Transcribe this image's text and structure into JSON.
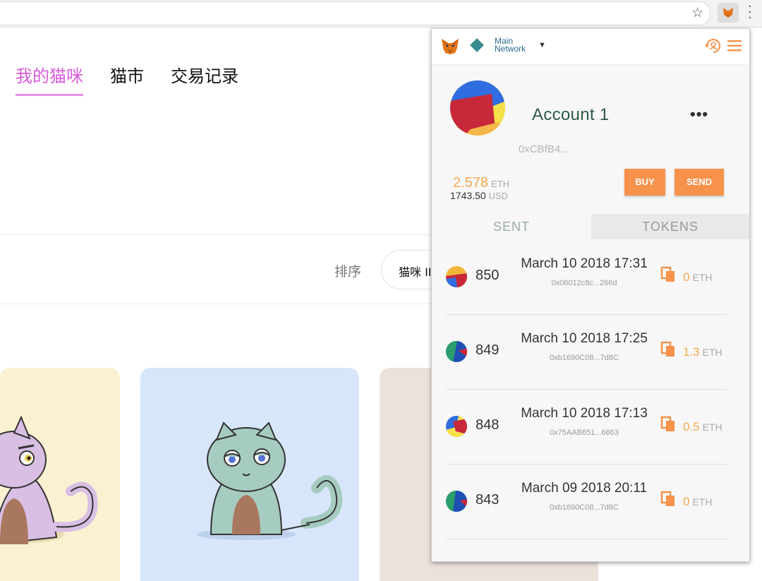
{
  "page": {
    "nav_tabs": [
      "我的猫咪",
      "猫市",
      "交易记录"
    ],
    "sort_label": "排序",
    "sort_value": "猫咪 II"
  },
  "metamask": {
    "network_line1": "Main",
    "network_line2": "Network",
    "account_name": "Account 1",
    "account_menu": "•••",
    "address": "0xCBfB4...",
    "balance_eth": "2.578",
    "balance_eth_unit": "ETH",
    "balance_usd": "1743.50",
    "balance_usd_unit": "USD",
    "buy_label": "BUY",
    "send_label": "SEND",
    "tabs": [
      "SENT",
      "TOKENS"
    ],
    "transactions": [
      {
        "id": "850",
        "date": "March 10 2018 17:31",
        "hash": "0x06012c8c...266d",
        "amount": "0",
        "unit": "ETH"
      },
      {
        "id": "849",
        "date": "March 10 2018 17:25",
        "hash": "0xb1690C08...7d8C",
        "amount": "1.3",
        "unit": "ETH"
      },
      {
        "id": "848",
        "date": "March 10 2018 17:13",
        "hash": "0x75AAB651...6863",
        "amount": "0.5",
        "unit": "ETH"
      },
      {
        "id": "843",
        "date": "March 09 2018 20:11",
        "hash": "0xb1690C08...7d8C",
        "amount": "0",
        "unit": "ETH"
      }
    ]
  },
  "colors": {
    "accent_pink": "#d95ad8",
    "metamask_orange": "#f6924a",
    "account_green": "#2f5a45"
  }
}
